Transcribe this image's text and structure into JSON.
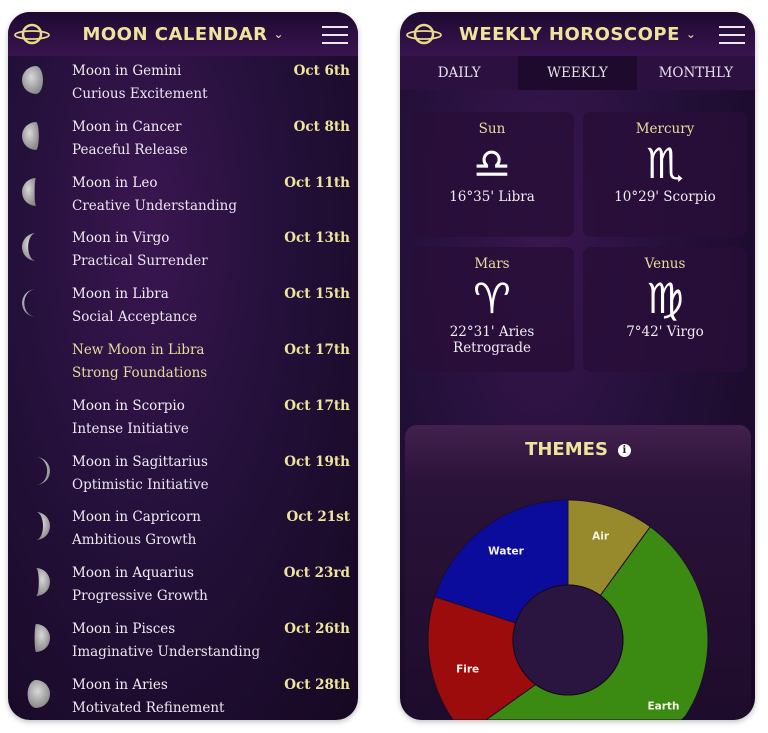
{
  "moon_calendar": {
    "title": "MOON CALENDAR",
    "items": [
      {
        "title": "Moon in Gemini",
        "subtitle": "Curious Excitement",
        "date": "Oct 6th",
        "illumination": 0.75,
        "side": "waning"
      },
      {
        "title": "Moon in Cancer",
        "subtitle": "Peaceful Release",
        "date": "Oct 8th",
        "illumination": 0.6,
        "side": "waning"
      },
      {
        "title": "Moon in Leo",
        "subtitle": "Creative Understanding",
        "date": "Oct 11th",
        "illumination": 0.45,
        "side": "waning"
      },
      {
        "title": "Moon in Virgo",
        "subtitle": "Practical Surrender",
        "date": "Oct 13th",
        "illumination": 0.22,
        "side": "waning"
      },
      {
        "title": "Moon in Libra",
        "subtitle": "Social Acceptance",
        "date": "Oct 15th",
        "illumination": 0.08,
        "side": "waning"
      },
      {
        "title": "New Moon in Libra",
        "subtitle": "Strong Foundations",
        "date": "Oct 17th",
        "illumination": 0,
        "side": "new",
        "highlight": true
      },
      {
        "title": "Moon in Scorpio",
        "subtitle": "Intense Initiative",
        "date": "Oct 17th",
        "illumination": 0,
        "side": "new"
      },
      {
        "title": "Moon in Sagittarius",
        "subtitle": "Optimistic Initiative",
        "date": "Oct 19th",
        "illumination": 0.1,
        "side": "waxing"
      },
      {
        "title": "Moon in Capricorn",
        "subtitle": "Ambitious Growth",
        "date": "Oct 21st",
        "illumination": 0.25,
        "side": "waxing"
      },
      {
        "title": "Moon in Aquarius",
        "subtitle": "Progressive Growth",
        "date": "Oct 23rd",
        "illumination": 0.4,
        "side": "waxing"
      },
      {
        "title": "Moon in Pisces",
        "subtitle": "Imaginative Understanding",
        "date": "Oct 26th",
        "illumination": 0.55,
        "side": "waxing"
      },
      {
        "title": "Moon in Aries",
        "subtitle": "Motivated Refinement",
        "date": "Oct 28th",
        "illumination": 0.8,
        "side": "waxing"
      }
    ]
  },
  "horoscope": {
    "title": "WEEKLY HOROSCOPE",
    "tabs": [
      {
        "label": "DAILY"
      },
      {
        "label": "WEEKLY",
        "active": true
      },
      {
        "label": "MONTHLY"
      }
    ],
    "planets": [
      {
        "planet": "Sun",
        "symbol": "♎",
        "value": "16°35' Libra"
      },
      {
        "planet": "Mercury",
        "symbol": "♏",
        "value": "10°29' Scorpio"
      },
      {
        "planet": "Mars",
        "symbol": "♈",
        "value": "22°31' Aries Retrograde"
      },
      {
        "planet": "Venus",
        "symbol": "♍",
        "value": "7°42' Virgo"
      }
    ],
    "themes_title": "THEMES",
    "info_icon": "i"
  },
  "colors": {
    "gold": "#efe49c",
    "background": "#24103a"
  },
  "chart_data": {
    "type": "pie",
    "donut": true,
    "categories": [
      "Air",
      "Earth",
      "Fire",
      "Water"
    ],
    "values": [
      10,
      50,
      20,
      20
    ],
    "colors": [
      "#978a2c",
      "#3b8a12",
      "#9c0c0c",
      "#0c0c9c"
    ]
  }
}
